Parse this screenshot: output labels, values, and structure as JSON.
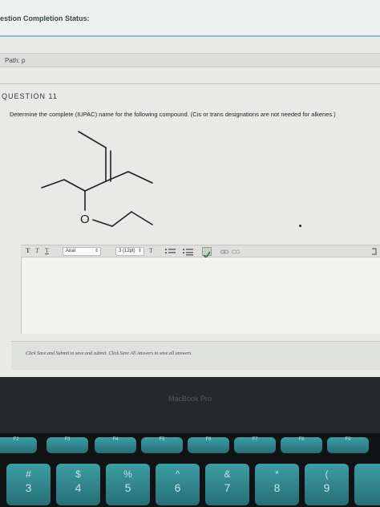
{
  "status": {
    "title": "estion Completion Status:"
  },
  "path": {
    "label": "Path: p"
  },
  "question": {
    "title": "QUESTION 11",
    "text": "Determine the complete (IUPAC) name for the following compound. (Cis or trans designations are not needed for alkenes.)",
    "oxygen_label": "O"
  },
  "toolbar": {
    "style_t1": "T",
    "style_t2": "T",
    "style_t3": "T",
    "font_family": "Arial",
    "font_size": "3 (12pt)",
    "text_color_label": "T",
    "arrow": "⇕"
  },
  "footer": {
    "instructions": "Click Save and Submit to save and submit. Click Save All Answers to save all answers."
  },
  "laptop": {
    "brand": "MacBook Pro"
  },
  "keys": {
    "fn": [
      "F2",
      "F3",
      "F4",
      "F5",
      "F6",
      "F7",
      "F8",
      "F9"
    ],
    "num": [
      {
        "top": "#",
        "bot": "3"
      },
      {
        "top": "$",
        "bot": "4"
      },
      {
        "top": "%",
        "bot": "5"
      },
      {
        "top": "^",
        "bot": "6"
      },
      {
        "top": "&",
        "bot": "7"
      },
      {
        "top": "*",
        "bot": "8"
      },
      {
        "top": "(",
        "bot": "9"
      }
    ]
  }
}
